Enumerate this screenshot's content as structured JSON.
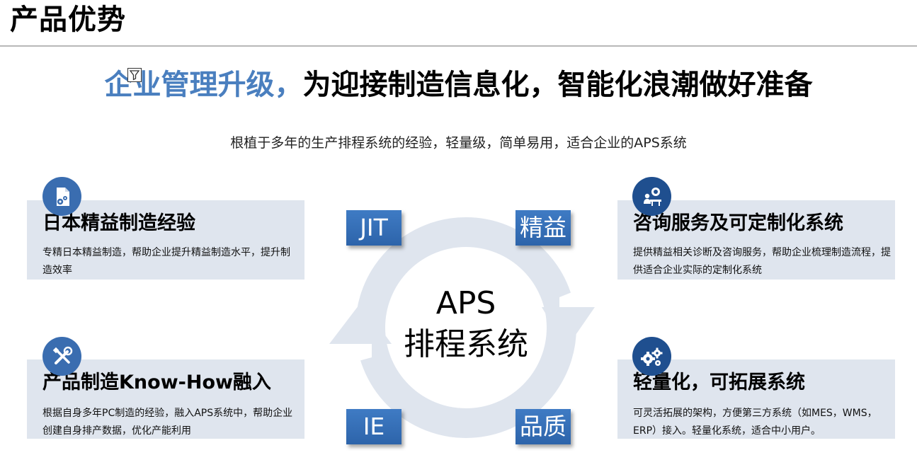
{
  "page": {
    "title": "产品优势"
  },
  "headline": {
    "accent": "企业管理升级，",
    "rest": "为迎接制造信息化，智能化浪潮做好准备"
  },
  "subtitle": "根植于多年的生产排程系统的经验，轻量级，简单易用，适合企业的APS系统",
  "center": {
    "line1": "APS",
    "line2": "排程系统"
  },
  "tags": {
    "jit": "JIT",
    "lean": "精益",
    "ie": "IE",
    "quality": "品质"
  },
  "cards": {
    "lean_experience": {
      "title": "日本精益制造经验",
      "desc": "专精日本精益制造，帮助企业提升精益制造水平，提升制造效率",
      "icon": "document-gear-icon"
    },
    "consulting": {
      "title": "咨询服务及可定制化系统",
      "desc": "提供精益相关诊断及咨询服务，帮助企业梳理制造流程，提供适合企业实际的定制化系统",
      "icon": "consultant-icon"
    },
    "knowhow": {
      "title": "产品制造Know-How融入",
      "desc": "根据自身多年PC制造的经验，融入APS系统中，帮助企业创建自身排产数据，优化产能利用",
      "icon": "tools-icon"
    },
    "lightweight": {
      "title": "轻量化，可拓展系统",
      "desc": "可灵活拓展的架构，方便第三方系统（如MES，WMS，ERP）接入。轻量化系统，适合中小用户。",
      "icon": "gears-icon"
    }
  },
  "colors": {
    "accent": "#4a7fbf",
    "card_bg": "#dfe5ee",
    "icon_bg": "#3a6db0",
    "tag_bg": "#3471b8",
    "cycle": "#dfe5ee"
  }
}
